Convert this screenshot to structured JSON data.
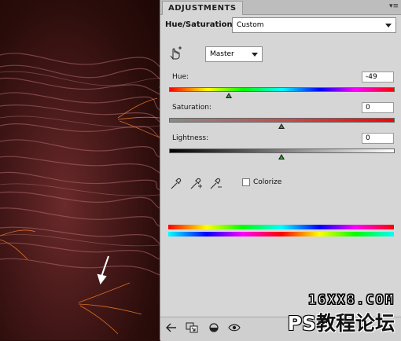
{
  "panel": {
    "tab_label": "ADJUSTMENTS",
    "menu_glyph": "▾≡",
    "title": "Hue/Saturation",
    "preset": "Custom",
    "channel": "Master",
    "colorize_label": "Colorize",
    "colorize_checked": false
  },
  "sliders": {
    "hue": {
      "label": "Hue:",
      "value": "-49"
    },
    "saturation": {
      "label": "Saturation:",
      "value": "0"
    },
    "lightness": {
      "label": "Lightness:",
      "value": "0"
    }
  },
  "icons": {
    "target_adjust": "hand-target-icon",
    "droppers": [
      "eyedropper-icon",
      "eyedropper-plus-icon",
      "eyedropper-minus-icon"
    ],
    "bottom": [
      "back-arrow-icon",
      "clip-to-layer-icon",
      "visibility-circle-icon",
      "eye-icon"
    ]
  },
  "watermark": {
    "line1": "16XX8.COM",
    "ps": "PS",
    "cn": "教程论坛"
  }
}
